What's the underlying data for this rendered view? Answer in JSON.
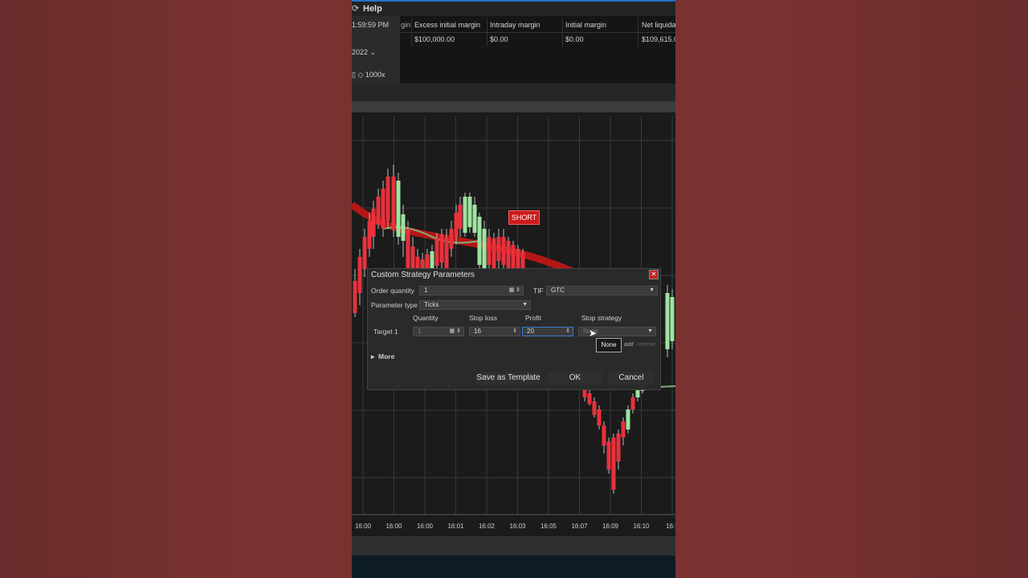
{
  "menu": {
    "help": "Help"
  },
  "account": {
    "time": "1:59:59 PM",
    "year_select": "2022",
    "zoom": "1000x",
    "partial_col": "gin",
    "columns": [
      {
        "header": "Excess initial margin",
        "value": "$100,000.00"
      },
      {
        "header": "Intraday margin",
        "value": "$0.00"
      },
      {
        "header": "Initial margin",
        "value": "$0.00"
      },
      {
        "header": "Net liquidat",
        "value": "$109,615.0"
      }
    ]
  },
  "chart": {
    "signal_label": "SHORT",
    "x_labels": [
      "16:00",
      "16:00",
      "16:00",
      "16:01",
      "16:02",
      "16:03",
      "16:05",
      "16:07",
      "16:09",
      "16:10",
      "16:1"
    ],
    "colors": {
      "up": "#9fe3a0",
      "down": "#e8313b",
      "band_red": "#b51616",
      "band_green": "#7fb07a",
      "grid": "#3a3a3a",
      "bg": "#1b1b1b"
    }
  },
  "dialog": {
    "title": "Custom Strategy Parameters",
    "order_quantity_label": "Order quantity",
    "order_quantity_value": "1",
    "tif_label": "TIF",
    "tif_value": "GTC",
    "parameter_type_label": "Parameter type",
    "parameter_type_value": "Ticks",
    "col_quantity": "Quantity",
    "col_stop_loss": "Stop loss",
    "col_profit": "Profit",
    "col_stop_strategy": "Stop strategy",
    "target_label": "Target 1",
    "target_quantity": "1",
    "stop_loss_value": "16",
    "profit_value": "20",
    "stop_strategy_value": "None",
    "popup_value": "None",
    "add_label": "add",
    "remove_label": "remove",
    "more_label": "More",
    "save_template": "Save as Template",
    "ok": "OK",
    "cancel": "Cancel"
  }
}
